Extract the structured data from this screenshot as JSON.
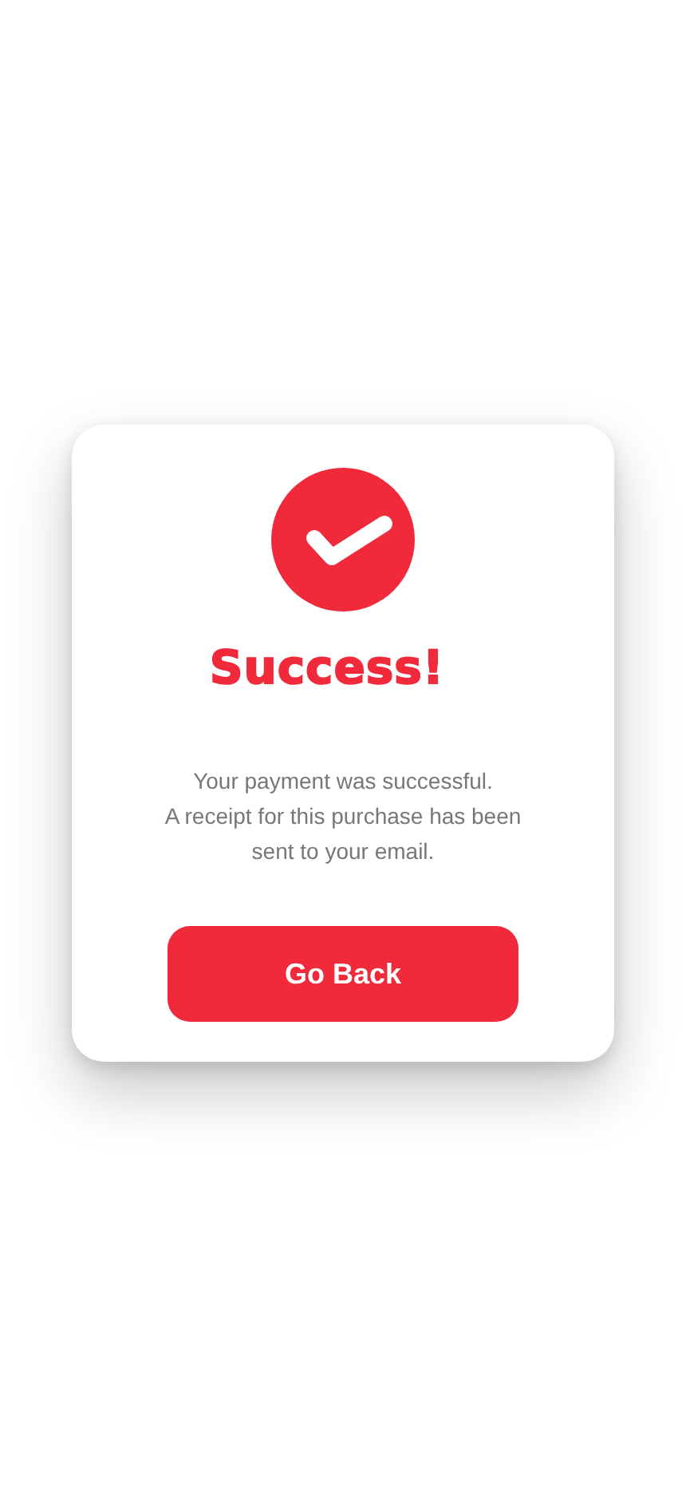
{
  "dialog": {
    "title": "Success!",
    "message_lines": [
      "Your payment was successful.",
      "A receipt for this purchase has been",
      "sent to your email."
    ],
    "button": "Go Back"
  }
}
